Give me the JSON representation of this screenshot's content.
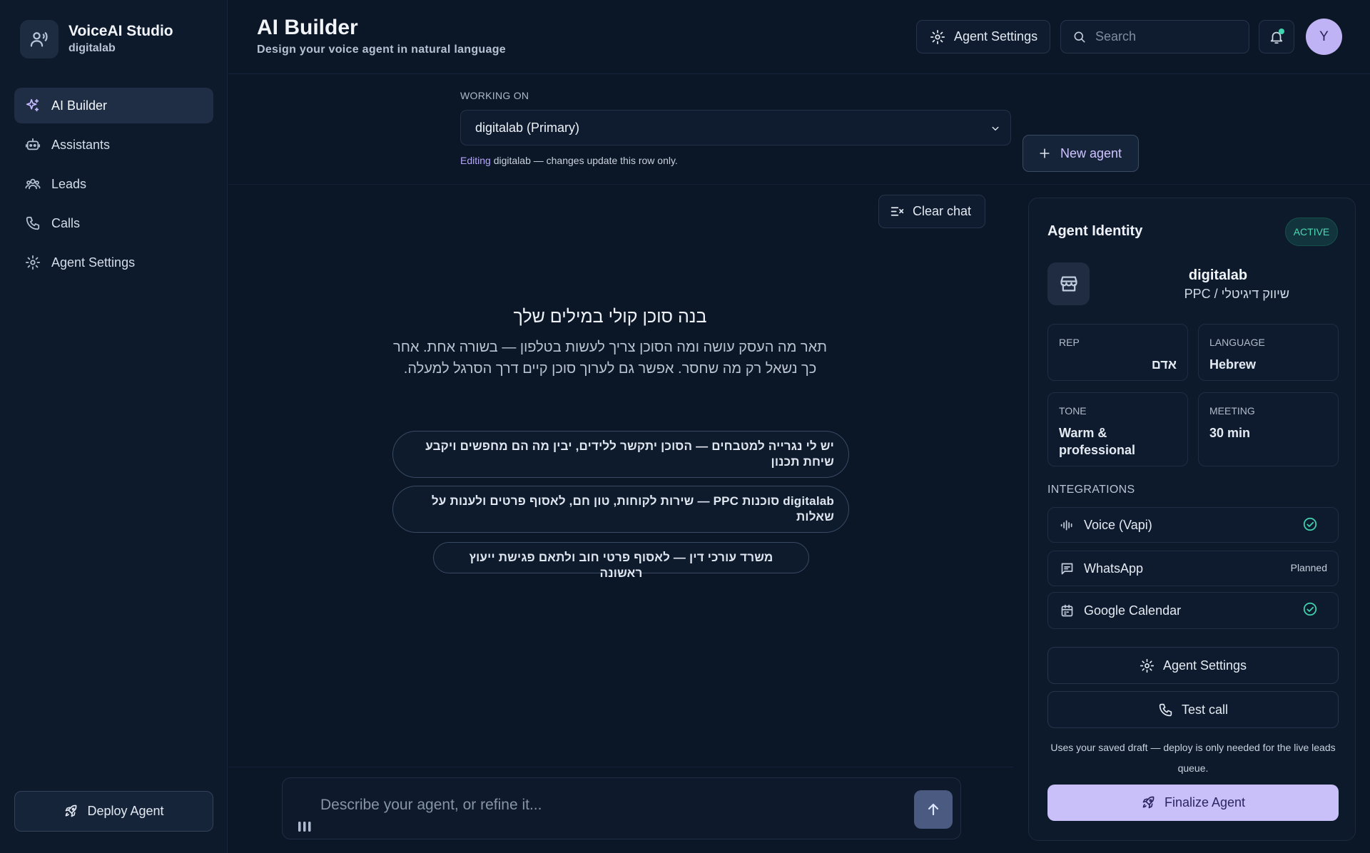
{
  "app": {
    "name": "VoiceAI Studio",
    "workspace": "digitalab"
  },
  "sidebar": {
    "items": [
      {
        "label": "AI Builder",
        "icon": "sparkles-icon",
        "active": true
      },
      {
        "label": "Assistants",
        "icon": "robot-icon",
        "active": false
      },
      {
        "label": "Leads",
        "icon": "users-icon",
        "active": false
      },
      {
        "label": "Calls",
        "icon": "phone-icon",
        "active": false
      },
      {
        "label": "Agent Settings",
        "icon": "gear-icon",
        "active": false
      }
    ],
    "deploy_label": "Deploy Agent"
  },
  "header": {
    "title": "AI Builder",
    "subtitle": "Design your voice agent in natural language",
    "settings_label": "Agent Settings",
    "search_placeholder": "Search",
    "avatar_initial": "Y",
    "has_notification": true
  },
  "working_on": {
    "label": "WORKING ON",
    "selected": "digitalab (Primary)",
    "note_prefix": "Editing",
    "note_rest": " digitalab — changes update this row only.",
    "new_agent_label": "New agent"
  },
  "chat": {
    "clear_label": "Clear chat",
    "intro_title": "בנה סוכן קולי במילים שלך",
    "intro_text": "תאר מה העסק עושה ומה הסוכן צריך לעשות בטלפון — בשורה אחת. אחר כך נשאל רק מה שחסר. אפשר גם לערוך סוכן קיים דרך הסרגל למעלה.",
    "suggestions": [
      "יש לי נגרייה למטבחים — הסוכן יתקשר ללידים, יבין מה הם מחפשים ויקבע שיחת תכנון",
      "digitalab סוכנות PPC — שירות לקוחות, טון חם, לאסוף פרטים ולענות על שאלות",
      "משרד עורכי דין — לאסוף פרטי חוב ולתאם פגישת ייעוץ ראשונה"
    ],
    "composer_placeholder": "Describe your agent, or refine it..."
  },
  "identity": {
    "title": "Agent Identity",
    "status": "ACTIVE",
    "name": "digitalab",
    "category": "שיווק דיגיטלי / PPC",
    "fields": {
      "rep": {
        "label": "REP",
        "value": "אדם"
      },
      "language": {
        "label": "LANGUAGE",
        "value": "Hebrew"
      },
      "tone": {
        "label": "TONE",
        "value": "Warm & professional"
      },
      "meeting": {
        "label": "MEETING",
        "value": "30 min"
      }
    },
    "integrations_label": "INTEGRATIONS",
    "integrations": [
      {
        "name": "Voice (Vapi)",
        "status": "connected"
      },
      {
        "name": "WhatsApp",
        "status": "Planned"
      },
      {
        "name": "Google Calendar",
        "status": "connected"
      }
    ],
    "settings_label": "Agent Settings",
    "test_call_label": "Test call",
    "note": "Uses your saved draft — deploy is only needed for the live leads queue.",
    "finalize_label": "Finalize Agent"
  },
  "colors": {
    "background": "#0b1626",
    "accent": "#c9bff9",
    "success": "#3fd3b0"
  }
}
